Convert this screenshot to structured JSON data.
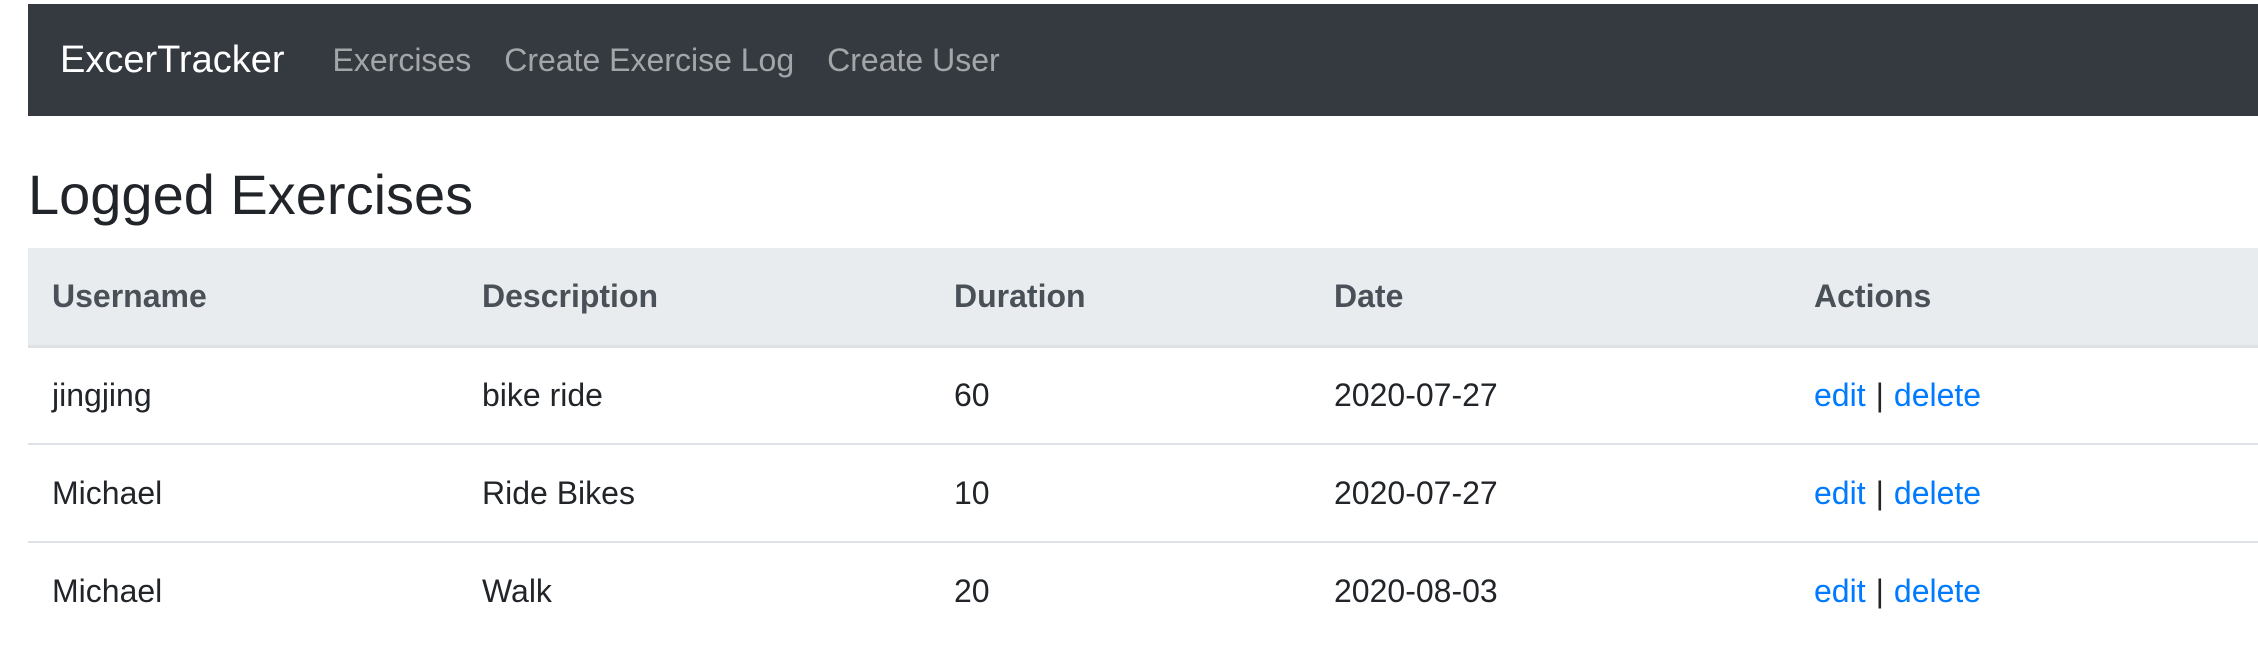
{
  "navbar": {
    "brand": "ExcerTracker",
    "links": [
      {
        "label": "Exercises"
      },
      {
        "label": "Create Exercise Log"
      },
      {
        "label": "Create User"
      }
    ]
  },
  "page": {
    "title": "Logged Exercises"
  },
  "table": {
    "headers": [
      "Username",
      "Description",
      "Duration",
      "Date",
      "Actions"
    ],
    "rows": [
      {
        "username": "jingjing",
        "description": "bike ride",
        "duration": "60",
        "date": "2020-07-27"
      },
      {
        "username": "Michael",
        "description": "Ride Bikes",
        "duration": "10",
        "date": "2020-07-27"
      },
      {
        "username": "Michael",
        "description": "Walk",
        "duration": "20",
        "date": "2020-08-03"
      }
    ],
    "actions": {
      "edit_label": "edit",
      "separator": "|",
      "delete_label": "delete"
    }
  },
  "colors": {
    "navbar_bg": "#343a40",
    "link": "#007bff",
    "header_bg": "#e9ecef"
  }
}
